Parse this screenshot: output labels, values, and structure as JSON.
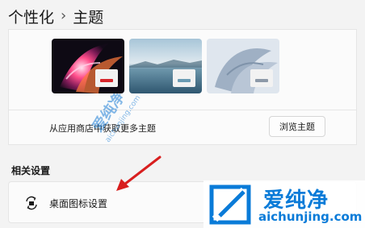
{
  "breadcrumb": {
    "parent": "个性化",
    "separator": "›",
    "current": "主题"
  },
  "themes": [
    {
      "name": "theme-glow",
      "accent": "#d6262c"
    },
    {
      "name": "theme-lake",
      "accent": "#6b9bb3"
    },
    {
      "name": "theme-bloom",
      "accent": "#8d99a8"
    }
  ],
  "store": {
    "text": "从应用商店中获取更多主题",
    "browse_label": "浏览主题"
  },
  "related": {
    "title": "相关设置",
    "desktop_icons_label": "桌面图标设置"
  },
  "watermark": {
    "brand": "爱纯净",
    "url": "aichunjing.com"
  },
  "colors": {
    "background": "#f3f3f3",
    "card": "#fbfbfb",
    "annotation_arrow": "#d81e1e",
    "watermark_blue": "#0a7bd8"
  }
}
